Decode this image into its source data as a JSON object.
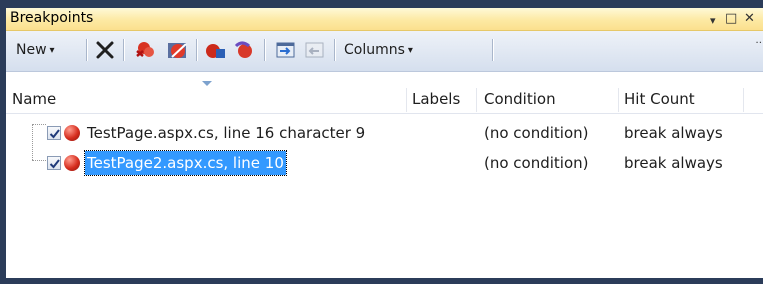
{
  "window": {
    "title": "Breakpoints",
    "dropdown_glyph": "▾",
    "restore_glyph": "□",
    "close_glyph": "✕"
  },
  "toolbar": {
    "new_label": "New",
    "columns_label": "Columns",
    "caret": "▾",
    "overflow": "‥",
    "icons": [
      "delete-icon",
      "delete-all-breakpoints-icon",
      "disable-all-breakpoints-icon",
      "go-to-source-icon",
      "go-to-disassembly-icon",
      "export-icon",
      "import-icon"
    ]
  },
  "columns": {
    "name": "Name",
    "labels": "Labels",
    "condition": "Condition",
    "hit_count": "Hit Count"
  },
  "rows": [
    {
      "checked": true,
      "name": "TestPage.aspx.cs, line 16 character 9",
      "condition": "(no condition)",
      "hit_count": "break always",
      "selected": false
    },
    {
      "checked": true,
      "name": "TestPage2.aspx.cs, line 10",
      "condition": "(no condition)",
      "hit_count": "break always",
      "selected": true
    }
  ],
  "colors": {
    "title_bar": "#fde9a3",
    "selection": "#3399ff",
    "breakpoint": "#d62e1f",
    "frame": "#2b3c59"
  }
}
